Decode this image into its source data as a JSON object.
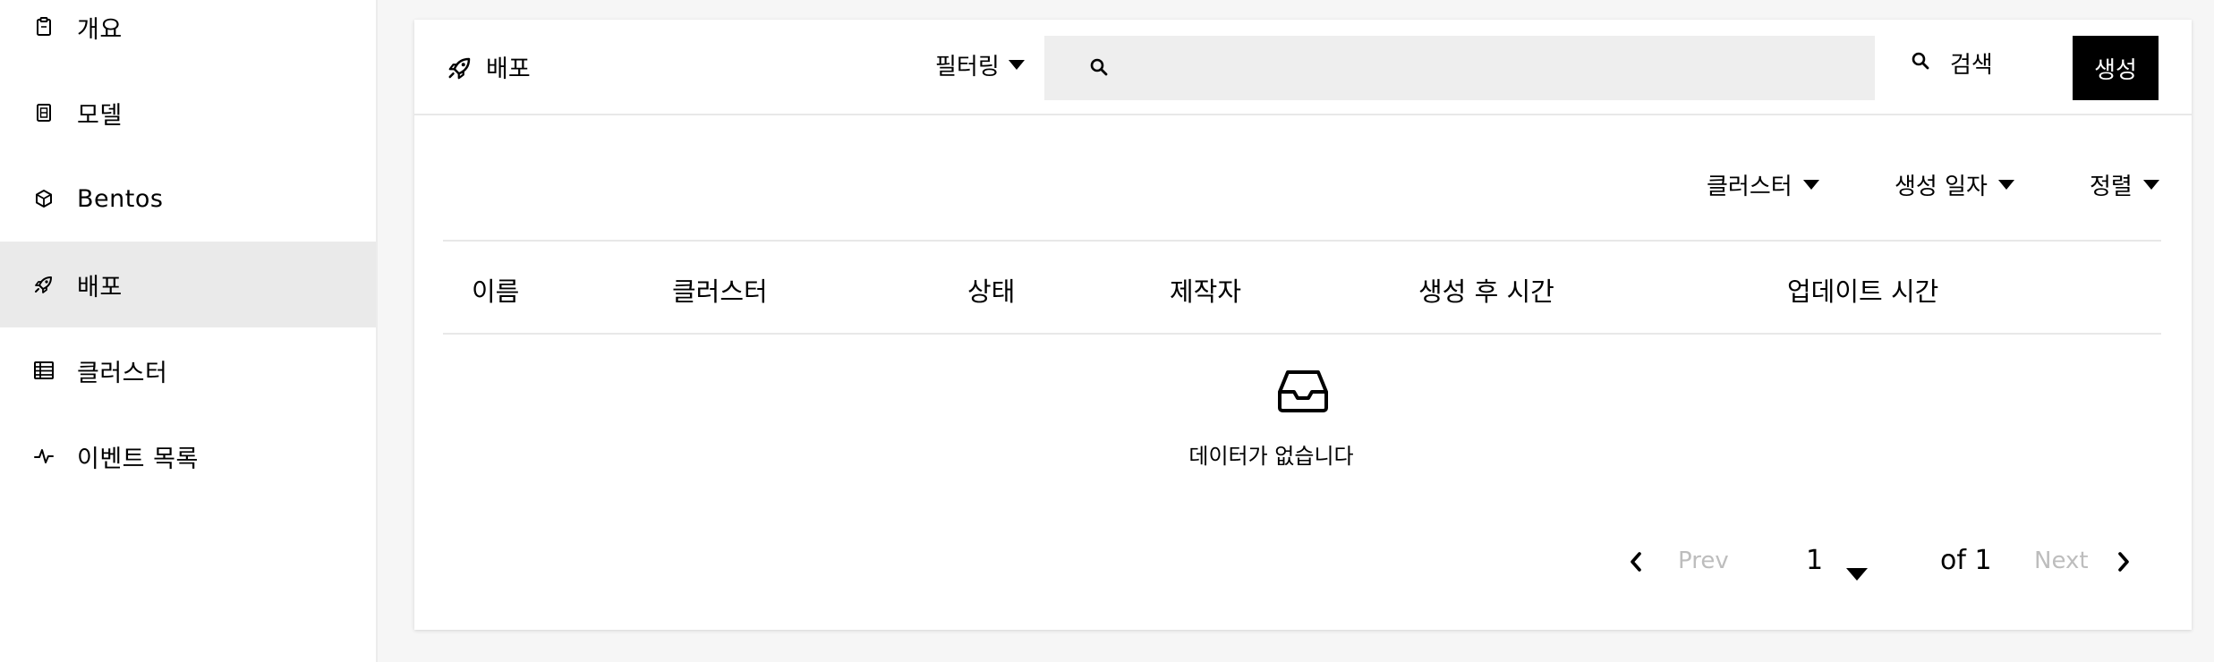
{
  "sidebar": {
    "items": [
      {
        "label": "개요",
        "icon": "clipboard-icon",
        "active": false
      },
      {
        "label": "모델",
        "icon": "model-file-icon",
        "active": false
      },
      {
        "label": "Bentos",
        "icon": "box-icon",
        "active": false
      },
      {
        "label": "배포",
        "icon": "rocket-icon",
        "active": true
      },
      {
        "label": "클러스터",
        "icon": "cluster-grid-icon",
        "active": false
      },
      {
        "label": "이벤트 목록",
        "icon": "activity-icon",
        "active": false
      }
    ]
  },
  "header": {
    "title": "배포",
    "icon": "rocket-icon",
    "filter_label": "필터링",
    "search_placeholder": "",
    "search_button": "검색",
    "create_button": "생성"
  },
  "toolbar": {
    "cluster": "클러스터",
    "created_date": "생성 일자",
    "sort": "정렬"
  },
  "table": {
    "columns": [
      "이름",
      "클러스터",
      "상태",
      "제작자",
      "생성 후 시간",
      "업데이트 시간"
    ],
    "rows": []
  },
  "empty_state": {
    "icon": "inbox-icon",
    "text": "데이터가 없습니다"
  },
  "pagination": {
    "prev": "Prev",
    "current_page": "1",
    "of_label": "of 1",
    "next": "Next"
  },
  "colors": {
    "accent": "#000000",
    "active_nav_bg": "#eaeaea",
    "search_bg": "#eeeeee",
    "disabled_text": "#bdbdbd"
  }
}
